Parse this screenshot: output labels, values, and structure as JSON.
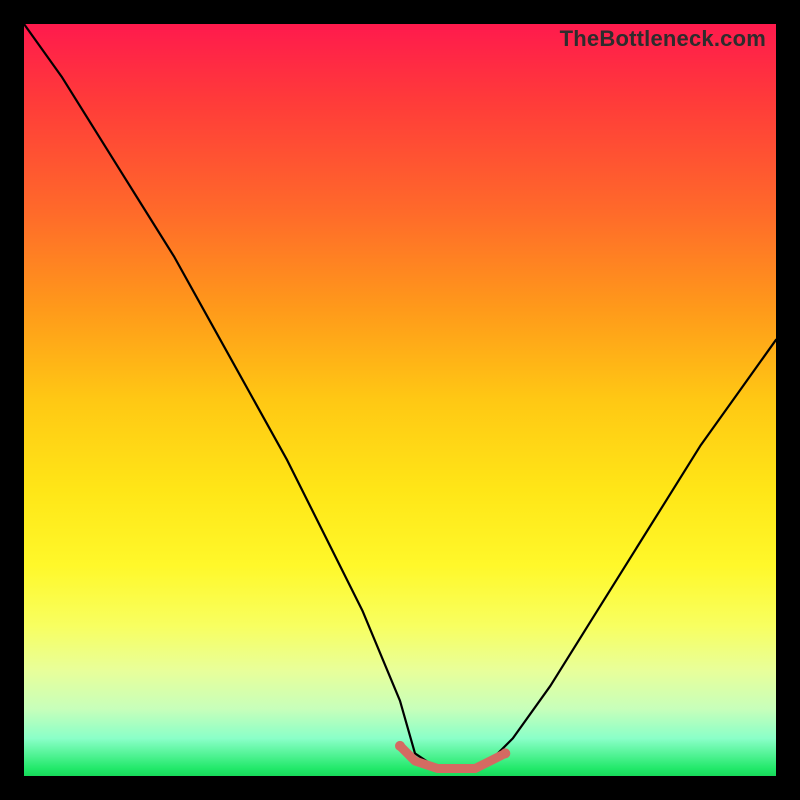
{
  "watermark": "TheBottleneck.com",
  "colors": {
    "frame": "#000000",
    "curve": "#000000",
    "highlight": "#d46a62",
    "gradient_top": "#ff1a4d",
    "gradient_bottom": "#18d85a"
  },
  "chart_data": {
    "type": "line",
    "title": "",
    "xlabel": "",
    "ylabel": "",
    "xlim": [
      0,
      100
    ],
    "ylim": [
      0,
      100
    ],
    "grid": false,
    "legend": false,
    "notes": "No axis ticks or numeric labels are shown; values are estimated from pixel positions normalized to 0–100. The curve is a V-shaped profile with a flat minimum segment near x≈52–62. A short thicker reddish overlay highlights the flat bottom of the curve.",
    "series": [
      {
        "name": "curve",
        "x": [
          0,
          5,
          10,
          15,
          20,
          25,
          30,
          35,
          40,
          45,
          50,
          52,
          55,
          58,
          60,
          62,
          65,
          70,
          75,
          80,
          85,
          90,
          95,
          100
        ],
        "values": [
          100,
          93,
          85,
          77,
          69,
          60,
          51,
          42,
          32,
          22,
          10,
          3,
          1,
          1,
          1,
          2,
          5,
          12,
          20,
          28,
          36,
          44,
          51,
          58
        ]
      },
      {
        "name": "bottom-highlight",
        "x": [
          50,
          52,
          55,
          58,
          60,
          62,
          64
        ],
        "values": [
          4,
          2,
          1,
          1,
          1,
          2,
          3
        ]
      }
    ]
  }
}
